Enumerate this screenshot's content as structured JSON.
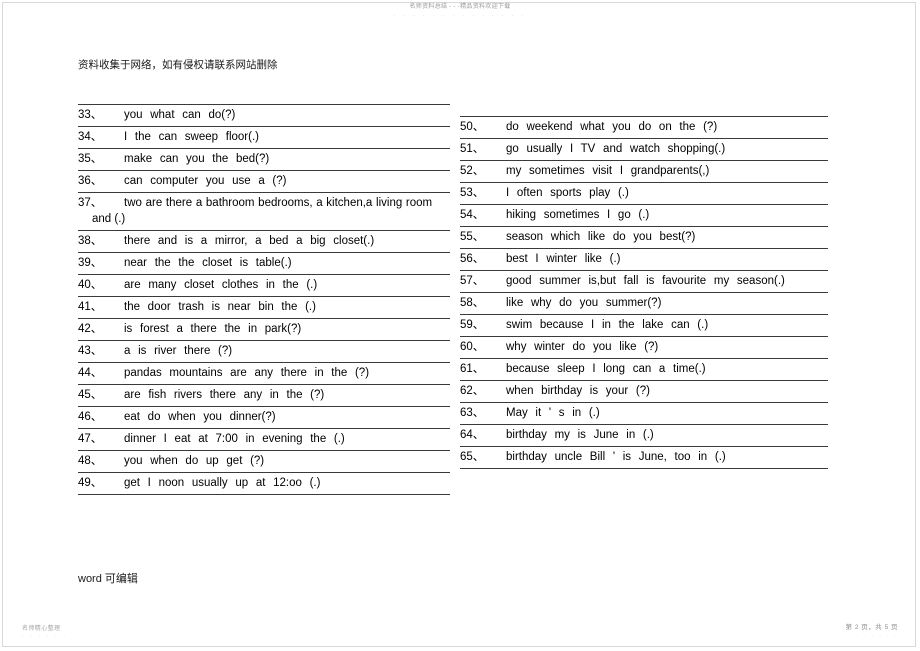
{
  "watermarks": {
    "top": "名师资料总结 - - -精品资料欢迎下载",
    "top_dots": "·  ·  ·  ·  ·  ·  ·  ·  ·  ·  ·  ·  ·  ·",
    "bottom_left": "名师精心整理",
    "bottom_left_dots": "·  ·  ·  ·  ·  ·",
    "bottom_right": "第 2 页，共 5 页",
    "bottom_right_dots": "·  ·  ·  ·  ·  ·"
  },
  "document": {
    "header_note": "资料收集于网络，如有侵权请联系网站删除",
    "footer_note": "word 可编辑"
  },
  "exercises": {
    "left_column": [
      {
        "num": "33、",
        "text": "you  what  can  do(?)",
        "wrap": false
      },
      {
        "num": "34、",
        "text": "I  the  can  sweep  floor(.)",
        "wrap": false
      },
      {
        "num": "35、",
        "text": "make  can  you  the  bed(?)",
        "wrap": false
      },
      {
        "num": "36、",
        "text": "can  computer  you  use  a (?)",
        "wrap": false
      },
      {
        "num": "37、",
        "text": "two are there a bathroom bedrooms, a kitchen,a living room",
        "cont": "and (.)",
        "wrap": true
      },
      {
        "num": "38、",
        "text": "there  and  is  a mirror,   a bed  a big closet(.)",
        "wrap": false
      },
      {
        "num": "39、",
        "text": "near  the  the  closet  is  table(.)",
        "wrap": false
      },
      {
        "num": "40、",
        "text": "are  many  closet  clothes  in  the (.)",
        "wrap": false
      },
      {
        "num": "41、",
        "text": "the  door  trash is  near  bin  the (.)",
        "wrap": false
      },
      {
        "num": "42、",
        "text": "is  forest  a  there  the  in  park(?)",
        "wrap": false
      },
      {
        "num": "43、",
        "text": "a  is  river  there (?)",
        "wrap": false
      },
      {
        "num": "44、",
        "text": "pandas mountains  are  any  there  in  the (?)",
        "wrap": false
      },
      {
        "num": "45、",
        "text": "are fish  rivers  there  any  in  the (?)",
        "wrap": false
      },
      {
        "num": "46、",
        "text": "eat do  when  you  dinner(?)",
        "wrap": false
      },
      {
        "num": "47、",
        "text": "dinner  I  eat  at  7:00  in  evening  the (.)",
        "wrap": false
      },
      {
        "num": "48、",
        "text": "you  when  do  up  get (?)",
        "wrap": false
      },
      {
        "num": "49、",
        "text": "get  I  noon  usually  up  at 12:oo (.)",
        "wrap": false
      }
    ],
    "right_column": [
      {
        "num": "50、",
        "text": "do  weekend  what  you  do  on  the (?)",
        "wrap": false
      },
      {
        "num": "51、",
        "text": "go  usually  I  TV  and  watch  shopping(.)",
        "wrap": false
      },
      {
        "num": "52、",
        "text": "my  sometimes  visit  I  grandparents(,)",
        "wrap": false
      },
      {
        "num": "53、",
        "text": "I  often  sports  play (.)",
        "wrap": false
      },
      {
        "num": "54、",
        "text": "hiking  sometimes  I  go (.)",
        "wrap": false
      },
      {
        "num": "55、",
        "text": "season which  like  do  you  best(?)",
        "wrap": false
      },
      {
        "num": "56、",
        "text": "best  I  winter  like (.)",
        "wrap": false
      },
      {
        "num": "57、",
        "text": "good  summer  is,but  fall  is  favourite  my season(.)",
        "wrap": false
      },
      {
        "num": "58、",
        "text": "like  why  do  you  summer(?)",
        "wrap": false
      },
      {
        "num": "59、",
        "text": "swim  because  I  in  the  lake  can (.)",
        "wrap": false
      },
      {
        "num": "60、",
        "text": "why  winter  do  you  like (?)",
        "wrap": false
      },
      {
        "num": "61、",
        "text": "because  sleep  I  long  can  a  time(.)",
        "wrap": false
      },
      {
        "num": "62、",
        "text": "when  birthday  is  your (?)",
        "wrap": false
      },
      {
        "num": "63、",
        "text": "May  it '  s in (.)",
        "wrap": false
      },
      {
        "num": "64、",
        "text": "birthday  my  is  June  in (.)",
        "wrap": false
      },
      {
        "num": "65、",
        "text": "birthday  uncle  Bill '  is  June, too  in (.)",
        "wrap": false
      }
    ]
  }
}
